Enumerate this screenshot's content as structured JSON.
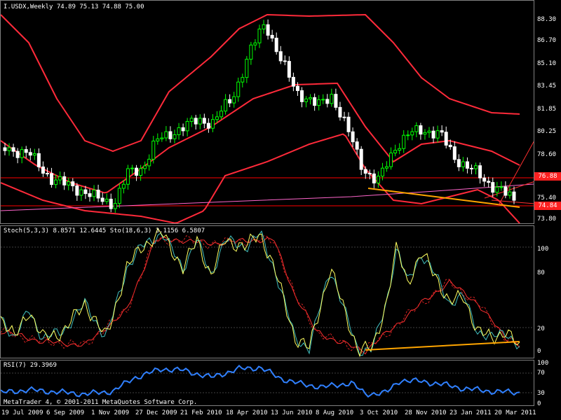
{
  "main": {
    "title": "I.USDX,Weekly  74.89 75.13 74.88 75.00",
    "price_ticks": [
      "88.30",
      "86.70",
      "85.10",
      "83.45",
      "81.85",
      "80.25",
      "78.60",
      "75.40",
      "73.80"
    ],
    "tag_upper": "76.88",
    "tag_lower": "74.84",
    "colors": {
      "bull": "#00ff00",
      "bear": "#ffffff",
      "band": "#ff2a3a",
      "hline": "#ff0000",
      "trend": "#ffa500",
      "diag": "#ff3030",
      "ma": "#ff66cc"
    }
  },
  "stoch": {
    "title": "Stoch(5,3,3) 8.8571 12.6445   Sto(18,6,3) 3.1156 6.5807",
    "ticks": [
      "100",
      "80",
      "20",
      "0"
    ]
  },
  "rsi": {
    "title": "RSI(7) 29.3969",
    "ticks": [
      "100",
      "70",
      "30",
      "0"
    ],
    "copyright": "MetaTrader 4, © 2001-2011 MetaQuotes Software Corp."
  },
  "time_axis": [
    "19 Jul 2009",
    "6 Sep 2009",
    "1 Nov 2009",
    "27 Dec 2009",
    "21 Feb 2010",
    "18 Apr 2010",
    "13 Jun 2010",
    "8 Aug 2010",
    "3 Oct 2010",
    "28 Nov 2010",
    "23 Jan 2011",
    "20 Mar 2011"
  ]
}
